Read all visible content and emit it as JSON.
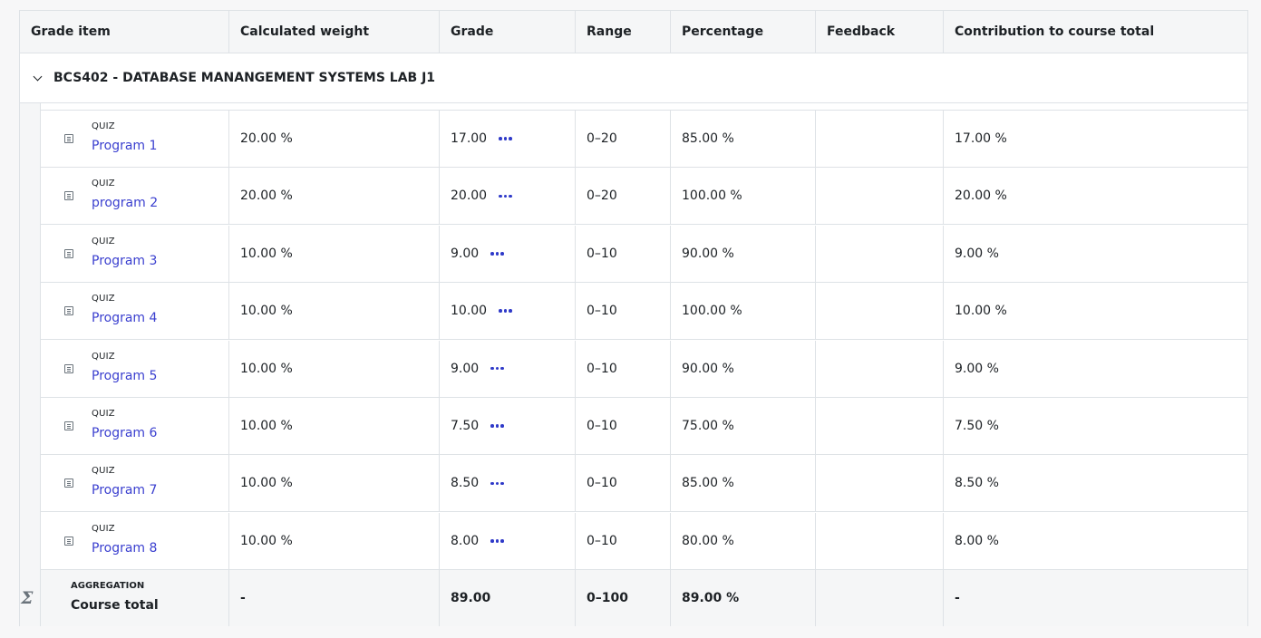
{
  "headers": {
    "grade_item": "Grade item",
    "calculated_weight": "Calculated weight",
    "grade": "Grade",
    "range": "Range",
    "percentage": "Percentage",
    "feedback": "Feedback",
    "contribution": "Contribution to course total"
  },
  "category": {
    "name": "BCS402 - DATABASE MANANGEMENT SYSTEMS LAB J1",
    "toggle_icon": "chevron-down-icon"
  },
  "items": [
    {
      "type": "QUIZ",
      "name": "Program 1",
      "weight": "20.00 %",
      "grade": "17.00",
      "range": "0–20",
      "percentage": "85.00 %",
      "feedback": "",
      "contribution": "17.00 %"
    },
    {
      "type": "QUIZ",
      "name": "program 2",
      "weight": "20.00 %",
      "grade": "20.00",
      "range": "0–20",
      "percentage": "100.00 %",
      "feedback": "",
      "contribution": "20.00 %"
    },
    {
      "type": "QUIZ",
      "name": "Program 3",
      "weight": "10.00 %",
      "grade": "9.00",
      "range": "0–10",
      "percentage": "90.00 %",
      "feedback": "",
      "contribution": "9.00 %"
    },
    {
      "type": "QUIZ",
      "name": "Program 4",
      "weight": "10.00 %",
      "grade": "10.00",
      "range": "0–10",
      "percentage": "100.00 %",
      "feedback": "",
      "contribution": "10.00 %"
    },
    {
      "type": "QUIZ",
      "name": "Program 5",
      "weight": "10.00 %",
      "grade": "9.00",
      "range": "0–10",
      "percentage": "90.00 %",
      "feedback": "",
      "contribution": "9.00 %"
    },
    {
      "type": "QUIZ",
      "name": "Program 6",
      "weight": "10.00 %",
      "grade": "7.50",
      "range": "0–10",
      "percentage": "75.00 %",
      "feedback": "",
      "contribution": "7.50 %"
    },
    {
      "type": "QUIZ",
      "name": "Program 7",
      "weight": "10.00 %",
      "grade": "8.50",
      "range": "0–10",
      "percentage": "85.00 %",
      "feedback": "",
      "contribution": "8.50 %"
    },
    {
      "type": "QUIZ",
      "name": "Program 8",
      "weight": "10.00 %",
      "grade": "8.00",
      "range": "0–10",
      "percentage": "80.00 %",
      "feedback": "",
      "contribution": "8.00 %"
    }
  ],
  "total": {
    "type": "AGGREGATION",
    "name": "Course total",
    "weight": "-",
    "grade": "89.00",
    "range": "0–100",
    "percentage": "89.00 %",
    "feedback": "",
    "contribution": "-"
  },
  "icons": {
    "item_icon": "quiz-icon",
    "actions_icon": "more-actions-icon",
    "total_icon": "sigma-icon"
  },
  "colors": {
    "link": "#3a3fcf",
    "header_bg": "#f5f6f7",
    "border": "#dee2e6"
  }
}
